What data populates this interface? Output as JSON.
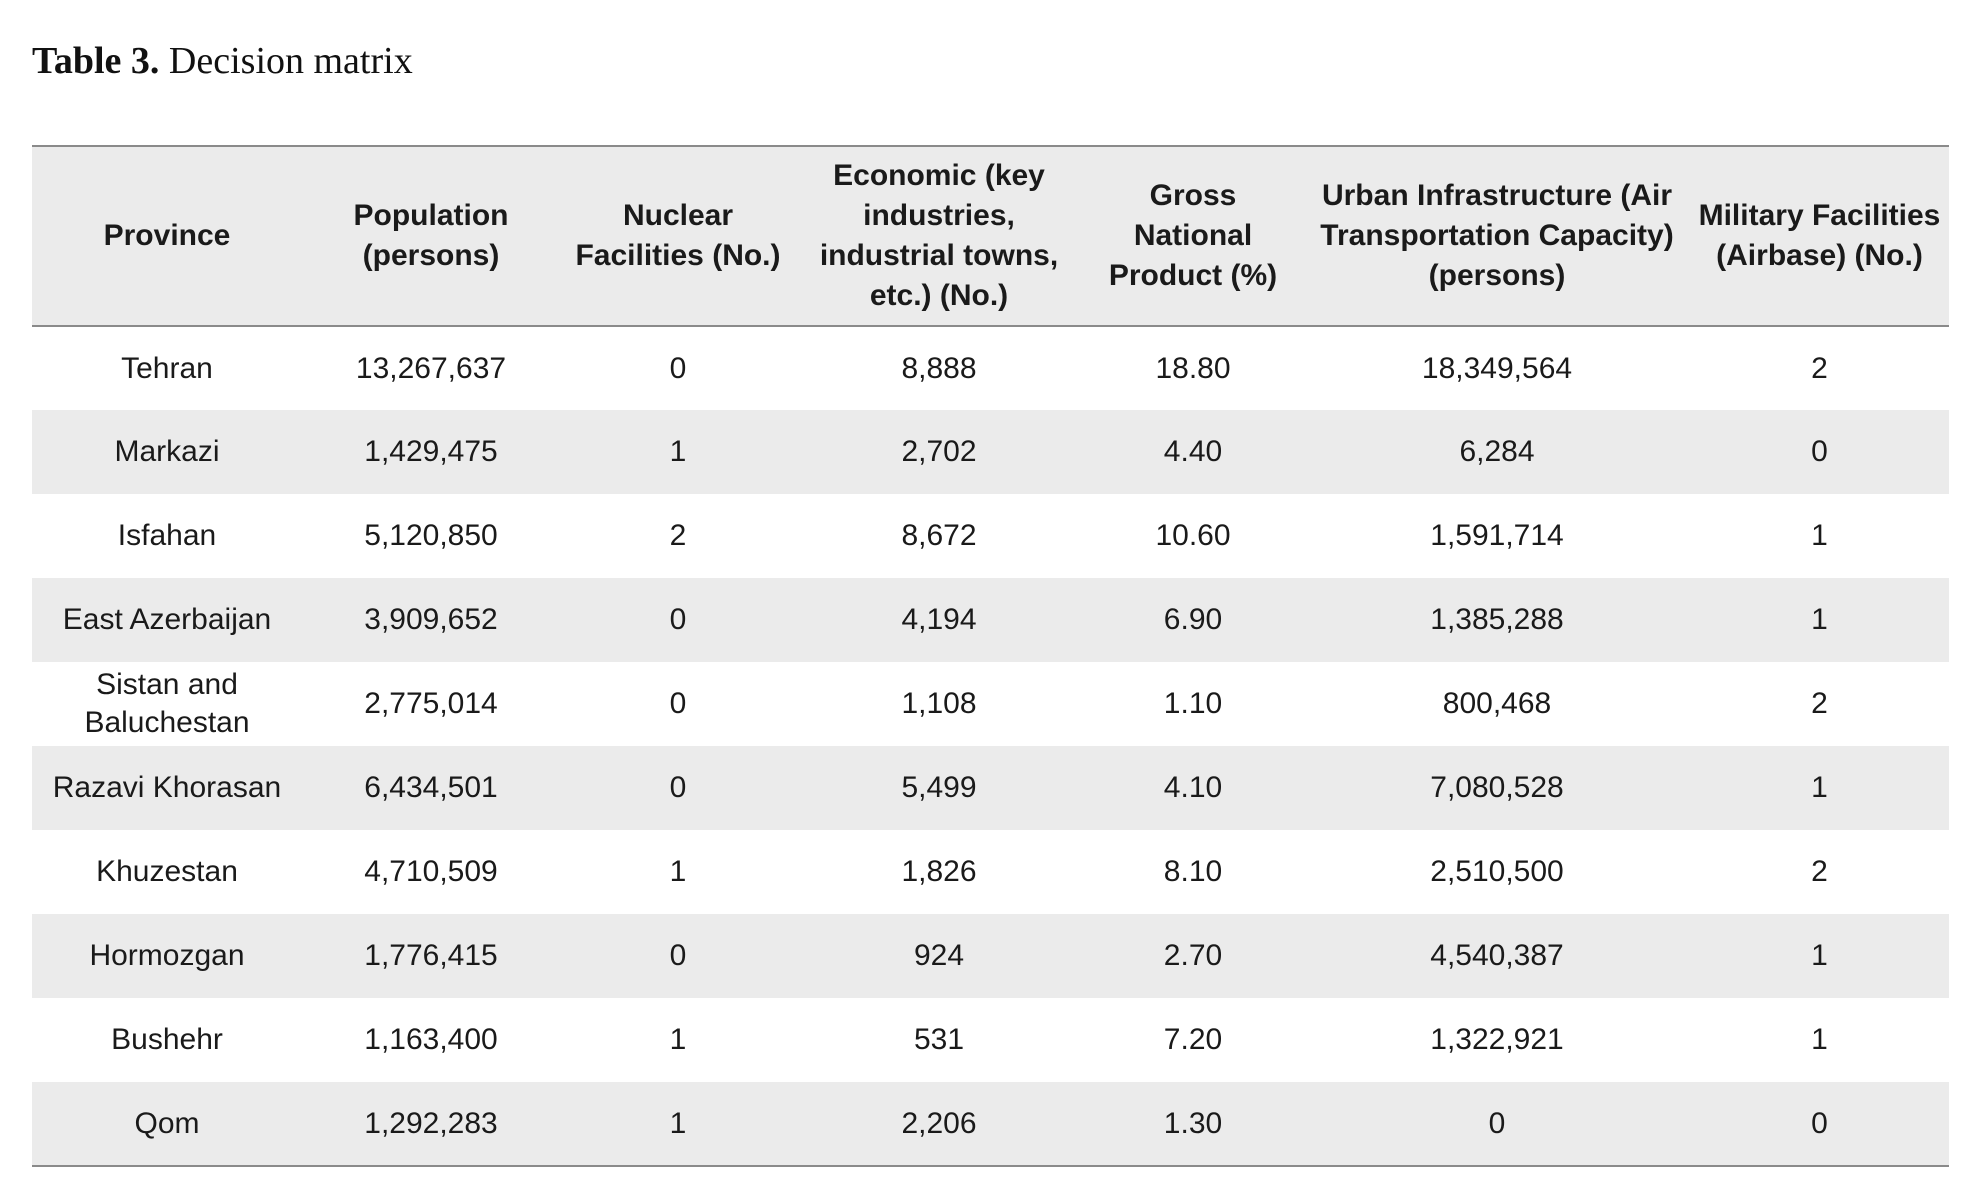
{
  "caption": {
    "label": "Table 3.",
    "text": " Decision matrix"
  },
  "table": {
    "headers": [
      "Province",
      "Population (persons)",
      "Nuclear Facilities (No.)",
      "Economic (key industries, industrial towns, etc.) (No.)",
      "Gross National Product (%)",
      "Urban Infrastructure (Air Transportation Capacity) (persons)",
      "Military Facilities (Airbase) (No.)"
    ],
    "rows": [
      [
        "Tehran",
        "13,267,637",
        "0",
        "8,888",
        "18.80",
        "18,349,564",
        "2"
      ],
      [
        "Markazi",
        "1,429,475",
        "1",
        "2,702",
        "4.40",
        "6,284",
        "0"
      ],
      [
        "Isfahan",
        "5,120,850",
        "2",
        "8,672",
        "10.60",
        "1,591,714",
        "1"
      ],
      [
        "East Azerbaijan",
        "3,909,652",
        "0",
        "4,194",
        "6.90",
        "1,385,288",
        "1"
      ],
      [
        "Sistan and Baluchestan",
        "2,775,014",
        "0",
        "1,108",
        "1.10",
        "800,468",
        "2"
      ],
      [
        "Razavi Khorasan",
        "6,434,501",
        "0",
        "5,499",
        "4.10",
        "7,080,528",
        "1"
      ],
      [
        "Khuzestan",
        "4,710,509",
        "1",
        "1,826",
        "8.10",
        "2,510,500",
        "2"
      ],
      [
        "Hormozgan",
        "1,776,415",
        "0",
        "924",
        "2.70",
        "4,540,387",
        "1"
      ],
      [
        "Bushehr",
        "1,163,400",
        "1",
        "531",
        "7.20",
        "1,322,921",
        "1"
      ],
      [
        "Qom",
        "1,292,283",
        "1",
        "2,206",
        "1.30",
        "0",
        "0"
      ]
    ]
  }
}
